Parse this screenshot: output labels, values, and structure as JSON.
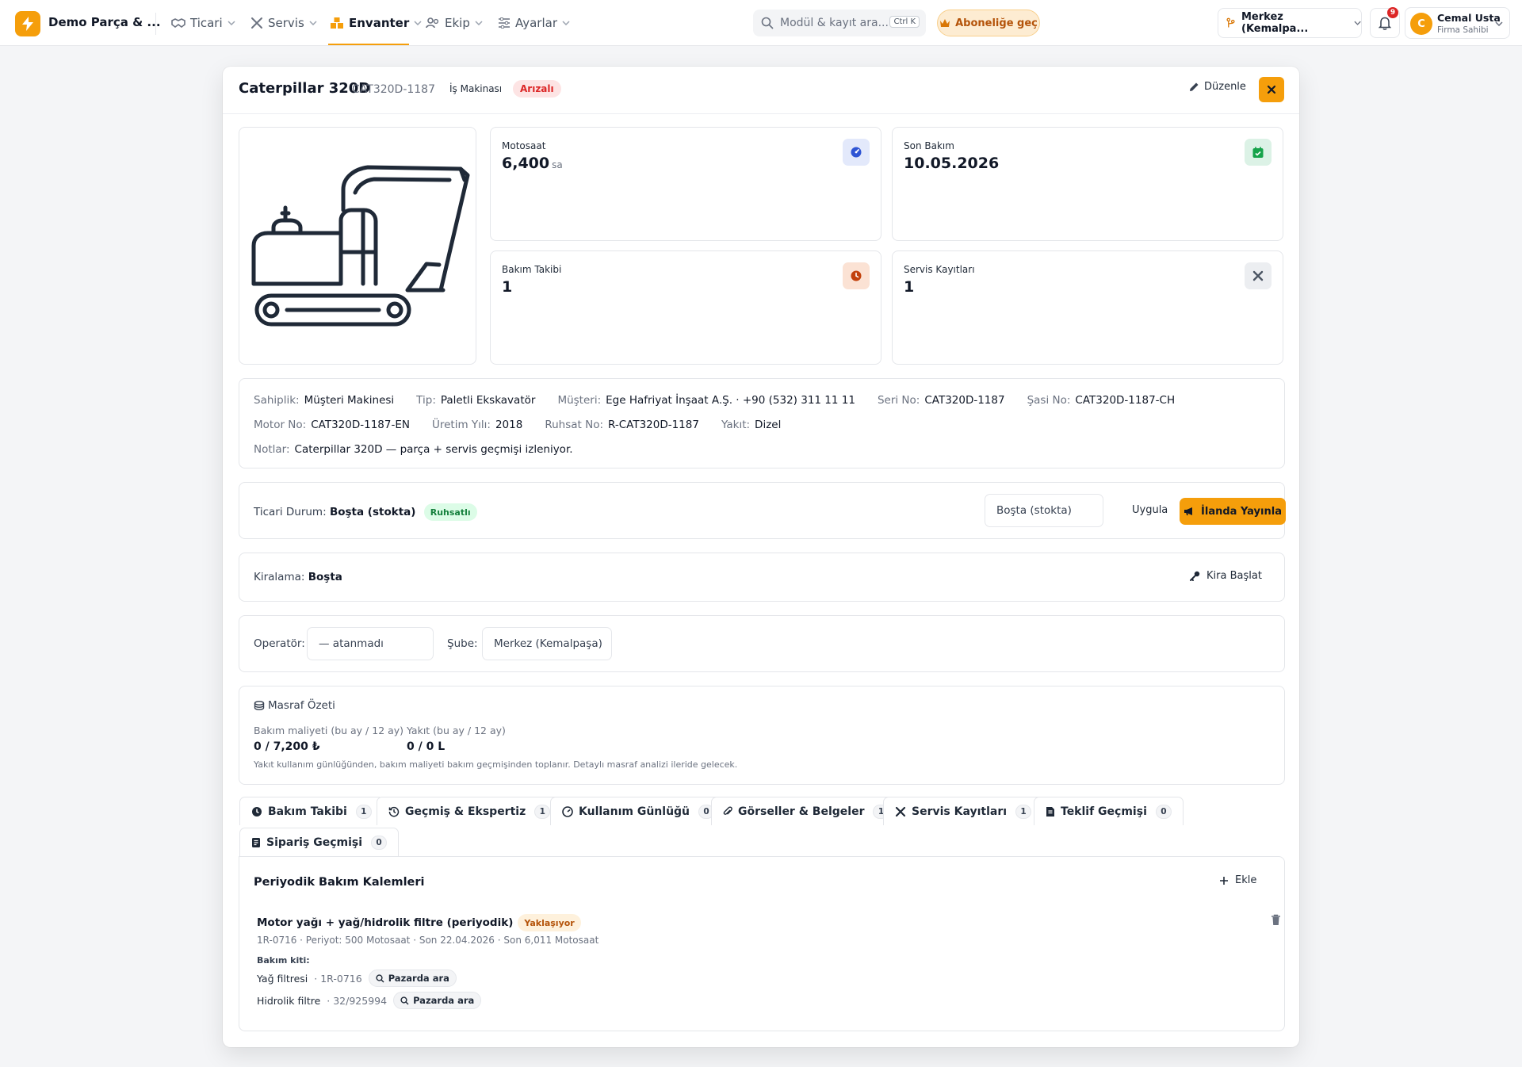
{
  "topbar": {
    "brand": "Demo Parça & ...",
    "nav": [
      {
        "label": "Ticari"
      },
      {
        "label": "Servis"
      },
      {
        "label": "Envanter"
      },
      {
        "label": "Ekip"
      },
      {
        "label": "Ayarlar"
      }
    ],
    "search_placeholder": "Modül & kayıt ara...",
    "search_shortcut": "Ctrl K",
    "subscribe_label": "Aboneliğe geç",
    "branch": "Merkez (Kemalpa...",
    "notification_count": "9",
    "user_initial": "C",
    "user_name": "Cemal Usta",
    "user_role": "Firma Sahibi",
    "accent_color": "#f59e0b"
  },
  "machine": {
    "title": "Caterpillar 320D",
    "code": "CAT320D-1187",
    "type": "İş Makinası",
    "status": "Arızalı",
    "edit_label": "Düzenle"
  },
  "stats": {
    "motosaat_label": "Motosaat",
    "motosaat_value": "6,400",
    "motosaat_unit": "sa",
    "last_service_label": "Son Bakım",
    "last_service_value": "10.05.2026",
    "maint_label": "Bakım Takibi",
    "maint_value": "1",
    "service_label": "Servis Kayıtları",
    "service_value": "1"
  },
  "details": {
    "row1": [
      {
        "k": "Sahiplik:",
        "v": "Müşteri Makinesi"
      },
      {
        "k": "Tip:",
        "v": "Paletli Ekskavatör"
      },
      {
        "k": "Müşteri:",
        "v": "Ege Hafriyat İnşaat A.Ş. · +90 (532) 311 11 11"
      },
      {
        "k": "Seri No:",
        "v": "CAT320D-1187"
      },
      {
        "k": "Şasi No:",
        "v": "CAT320D-1187-CH"
      }
    ],
    "row2": [
      {
        "k": "Motor No:",
        "v": "CAT320D-1187-EN"
      },
      {
        "k": "Üretim Yılı:",
        "v": "2018"
      },
      {
        "k": "Ruhsat No:",
        "v": "R-CAT320D-1187"
      },
      {
        "k": "Yakıt:",
        "v": "Dizel"
      }
    ],
    "notes_k": "Notlar:",
    "notes_v": "Caterpillar 320D — parça + servis geçmişi izleniyor."
  },
  "commercial": {
    "label": "Ticari Durum:",
    "value": "Boşta (stokta)",
    "badge": "Ruhsatlı",
    "select_value": "Boşta (stokta)",
    "apply_label": "Uygula",
    "publish_label": "İlanda Yayınla"
  },
  "rental": {
    "label": "Kiralama:",
    "value": "Boşta",
    "start_label": "Kira Başlat"
  },
  "assign": {
    "operator_label": "Operatör:",
    "operator_value": "— atanmadı",
    "branch_label": "Şube:",
    "branch_value": "Merkez (Kemalpaşa)"
  },
  "cost": {
    "title": "Masraf Özeti",
    "maint_k": "Bakım maliyeti (bu ay / 12 ay)",
    "maint_v": "0 / 7,200 ₺",
    "fuel_k": "Yakıt (bu ay / 12 ay)",
    "fuel_v": "0 / 0 L",
    "note": "Yakıt kullanım günlüğünden, bakım maliyeti bakım geçmişinden toplanır. Detaylı masraf analizi ileride gelecek."
  },
  "tabs": [
    {
      "label": "Bakım Takibi",
      "count": "1"
    },
    {
      "label": "Geçmiş & Ekspertiz",
      "count": "1"
    },
    {
      "label": "Kullanım Günlüğü",
      "count": "0"
    },
    {
      "label": "Görseller & Belgeler",
      "count": "1"
    },
    {
      "label": "Servis Kayıtları",
      "count": "1"
    },
    {
      "label": "Teklif Geçmişi",
      "count": "0"
    },
    {
      "label": "Sipariş Geçmişi",
      "count": "0"
    }
  ],
  "maintenance": {
    "title": "Periyodik Bakım Kalemleri",
    "add_label": "Ekle",
    "item_title": "Motor yağı + yağ/hidrolik filtre (periyodik)",
    "item_badge": "Yaklaşıyor",
    "item_meta": "1R-0716 · Periyot: 500 Motosaat · Son 22.04.2026 · Son 6,011 Motosaat",
    "kit_label": "Bakım kiti:",
    "kit": [
      {
        "name": "Yağ filtresi",
        "code": "· 1R-0716",
        "action": "Pazarda ara"
      },
      {
        "name": "Hidrolik filtre",
        "code": "· 32/925994",
        "action": "Pazarda ara"
      }
    ]
  }
}
